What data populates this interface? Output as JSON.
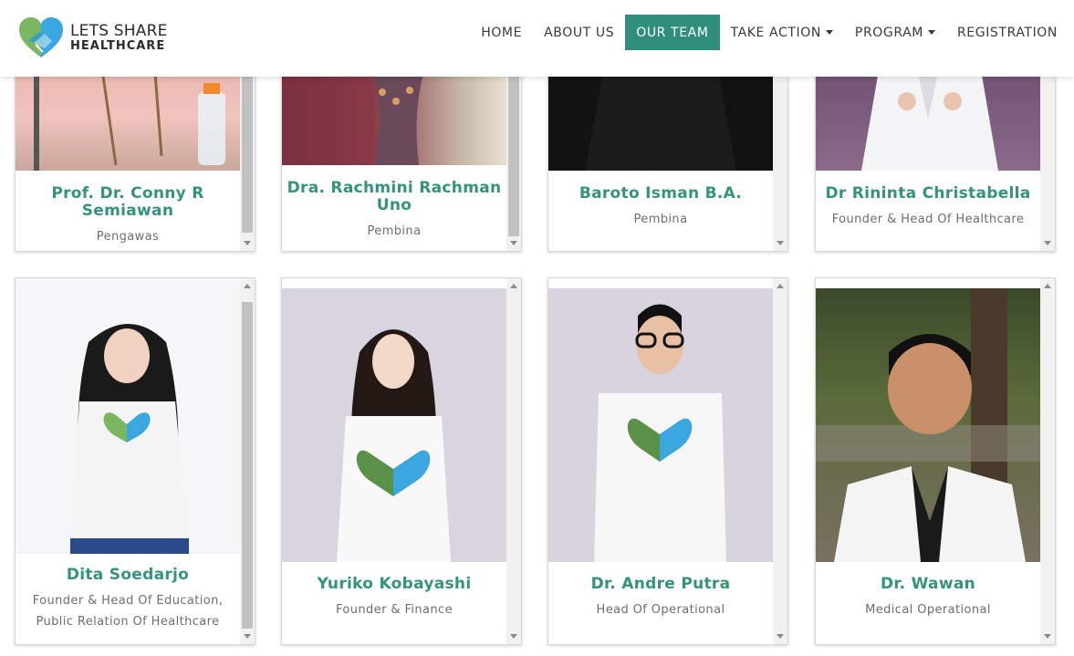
{
  "brand": {
    "line1": "LETS SHARE",
    "line2": "HEALTHCARE"
  },
  "nav": [
    {
      "label": "HOME",
      "active": false,
      "dropdown": false
    },
    {
      "label": "ABOUT US",
      "active": false,
      "dropdown": false
    },
    {
      "label": "OUR TEAM",
      "active": true,
      "dropdown": false
    },
    {
      "label": "TAKE ACTION",
      "active": false,
      "dropdown": true
    },
    {
      "label": "PROGRAM",
      "active": false,
      "dropdown": true
    },
    {
      "label": "REGISTRATION",
      "active": false,
      "dropdown": false
    }
  ],
  "colors": {
    "accent": "#2f8f7c",
    "name": "#33937d"
  },
  "team_row1": [
    {
      "name": "Prof. Dr. Conny R Semiawan",
      "role": "Pengawas"
    },
    {
      "name": "Dra. Rachmini Rachman Uno",
      "role": "Pembina"
    },
    {
      "name": "Baroto Isman B.A.",
      "role": "Pembina"
    },
    {
      "name": "Dr Rininta Christabella",
      "role": "Founder & Head Of Healthcare"
    }
  ],
  "team_row2": [
    {
      "name": "Dita Soedarjo",
      "role": "Founder & Head Of Education, Public Relation Of Healthcare"
    },
    {
      "name": "Yuriko Kobayashi",
      "role": "Founder & Finance"
    },
    {
      "name": "Dr. Andre Putra",
      "role": "Head Of Operational"
    },
    {
      "name": "Dr. Wawan",
      "role": "Medical Operational"
    }
  ]
}
